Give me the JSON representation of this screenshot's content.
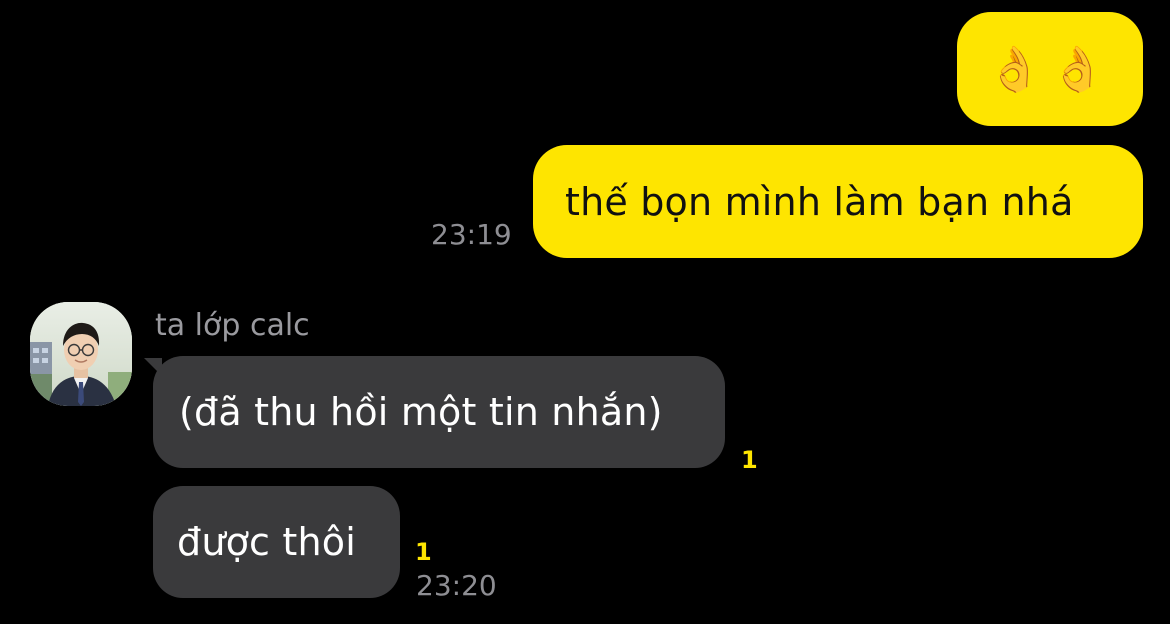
{
  "colors": {
    "background": "#000000",
    "outgoing_bubble": "#FEE500",
    "incoming_bubble": "#3A3A3C",
    "timestamp": "#8E8E93",
    "unread_badge": "#FEE500",
    "sender_name": "#9A9A9F"
  },
  "outgoing": [
    {
      "text": "👌👌",
      "icon": "ok-hand-emoji"
    },
    {
      "text": "thế bọn mình làm bạn nhá",
      "time": "23:19"
    }
  ],
  "incoming": {
    "sender": "ta lớp calc",
    "avatar_icon": "profile-photo",
    "messages": [
      {
        "text": "(đã thu hồi một tin nhắn)",
        "unread": "1"
      },
      {
        "text": "được thôi",
        "unread": "1",
        "time": "23:20"
      }
    ]
  }
}
